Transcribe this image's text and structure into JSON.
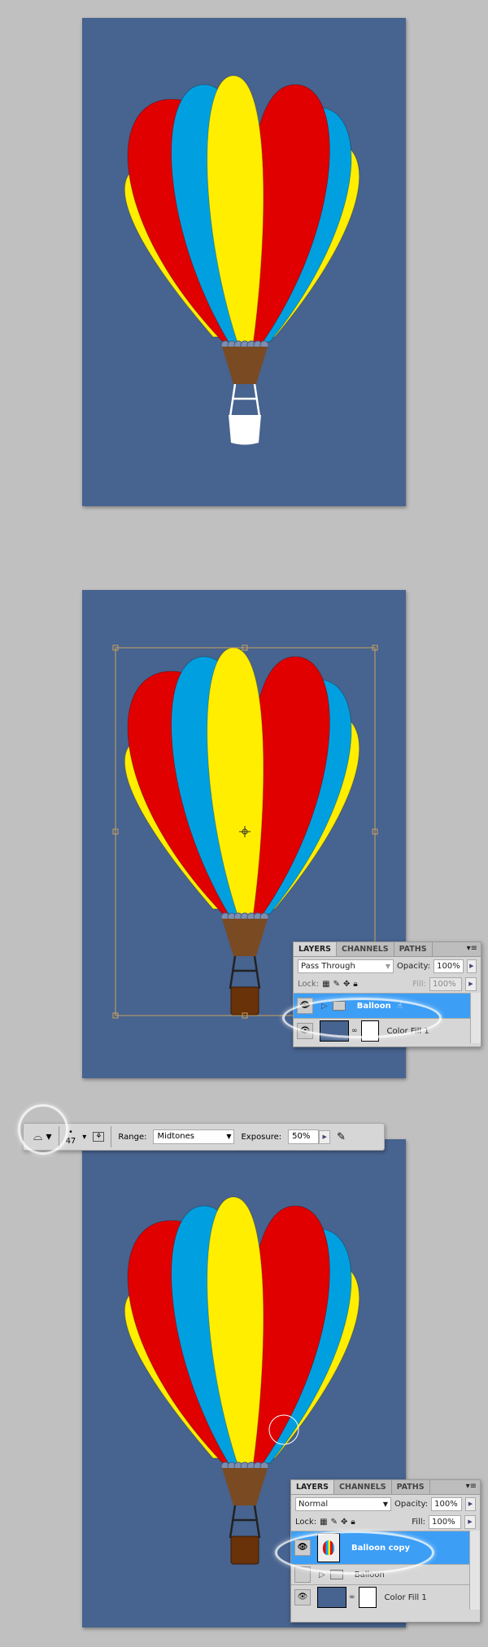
{
  "colors": {
    "canvas": "#47638f",
    "red": "#e00000",
    "blue": "#00a0e0",
    "yellow": "#ffee00",
    "brown": "#7a4a22",
    "selection": "#3d9ef5"
  },
  "panel1": {
    "tabs": [
      "LAYERS",
      "CHANNELS",
      "PATHS"
    ],
    "blend_mode": "Pass Through",
    "opacity_label": "Opacity:",
    "opacity": "100%",
    "lock_label": "Lock:",
    "fill_label": "Fill:",
    "fill": "100%",
    "layers": [
      {
        "name": "Balloon",
        "type": "group",
        "selected": true
      },
      {
        "name": "Color Fill 1",
        "type": "fill",
        "selected": false
      }
    ]
  },
  "toolbar": {
    "tool": "dodge/burn-tool",
    "brush_size": "47",
    "range_label": "Range:",
    "range": "Midtones",
    "exposure_label": "Exposure:",
    "exposure": "50%"
  },
  "panel2": {
    "tabs": [
      "LAYERS",
      "CHANNELS",
      "PATHS"
    ],
    "blend_mode": "Normal",
    "opacity_label": "Opacity:",
    "opacity": "100%",
    "lock_label": "Lock:",
    "fill_label": "Fill:",
    "fill": "100%",
    "layers": [
      {
        "name": "Balloon copy",
        "type": "pixel",
        "selected": true
      },
      {
        "name": "Balloon",
        "type": "group",
        "selected": false
      },
      {
        "name": "Color Fill 1",
        "type": "fill",
        "selected": false
      }
    ]
  }
}
